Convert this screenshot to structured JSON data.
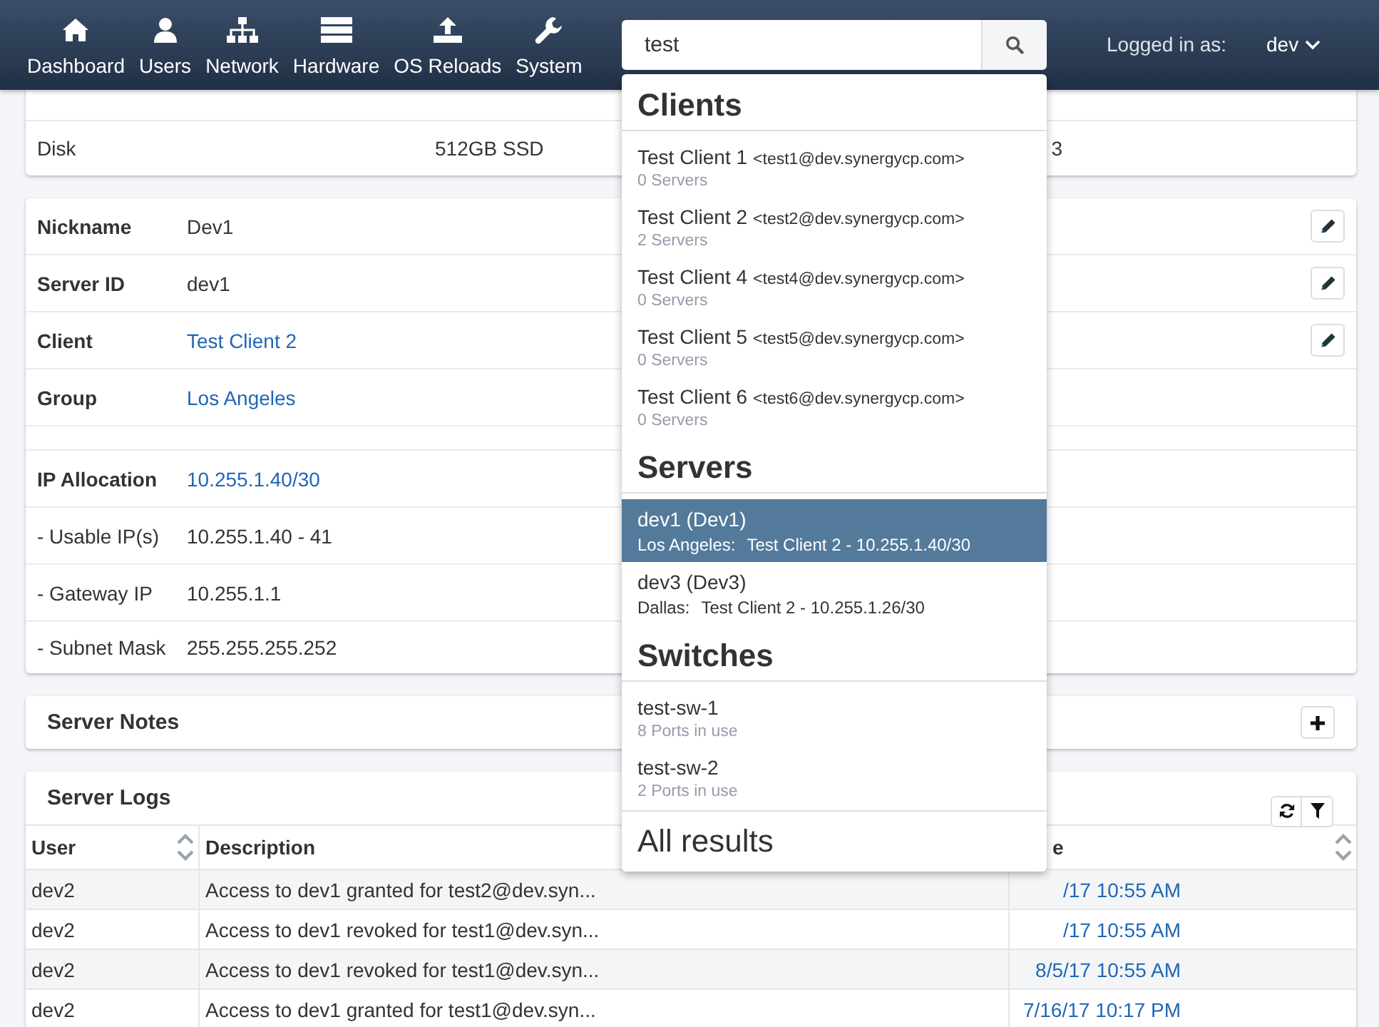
{
  "nav": [
    {
      "label": "Dashboard"
    },
    {
      "label": "Users"
    },
    {
      "label": "Network"
    },
    {
      "label": "Hardware"
    },
    {
      "label": "OS Reloads"
    },
    {
      "label": "System"
    }
  ],
  "search": {
    "value": "test"
  },
  "account": {
    "label": "Logged in as:",
    "name": "dev"
  },
  "specs": [
    {
      "label": "Disk",
      "value": "512GB SSD",
      "column_3": "3"
    }
  ],
  "details": [
    {
      "kind": "field",
      "label": "Nickname",
      "value": "Dev1",
      "bold": true,
      "link": false,
      "editable": true
    },
    {
      "kind": "field",
      "label": "Server ID",
      "value": "dev1",
      "bold": true,
      "link": false,
      "editable": true
    },
    {
      "kind": "field",
      "label": "Client",
      "value": "Test Client 2",
      "bold": true,
      "link": true,
      "editable": true
    },
    {
      "kind": "field",
      "label": "Group",
      "value": "Los Angeles",
      "bold": true,
      "link": true,
      "editable": false
    },
    {
      "kind": "spacer"
    },
    {
      "kind": "field",
      "label": "IP Allocation",
      "value": "10.255.1.40/30",
      "bold": true,
      "link": true,
      "editable": false
    },
    {
      "kind": "field",
      "label": "- Usable IP(s)",
      "value": "10.255.1.40 - 41",
      "bold": false,
      "link": false,
      "editable": false
    },
    {
      "kind": "field",
      "label": "- Gateway IP",
      "value": "10.255.1.1",
      "bold": false,
      "link": false,
      "editable": false
    },
    {
      "kind": "field",
      "label": "- Subnet Mask",
      "value": "255.255.255.252",
      "bold": false,
      "link": false,
      "editable": false
    }
  ],
  "notes": {
    "title": "Server Notes"
  },
  "logs": {
    "title": "Server Logs",
    "columns": [
      {
        "label": "User",
        "sortable": true
      },
      {
        "label": "Description"
      },
      {
        "label": "e",
        "sortable": true
      }
    ],
    "rows": [
      {
        "user": "dev2",
        "description": "Access to dev1 granted for test2@dev.syn...",
        "date": "/17 10:55 AM"
      },
      {
        "user": "dev2",
        "description": "Access to dev1 revoked for test1@dev.syn...",
        "date": "/17 10:55 AM"
      },
      {
        "user": "dev2",
        "description": "Access to dev1 revoked for test1@dev.syn...",
        "date": "8/5/17 10:55 AM"
      },
      {
        "user": "dev2",
        "description": "Access to dev1 granted for test1@dev.syn...",
        "date": "7/16/17 10:17 PM"
      }
    ]
  },
  "dropdown": {
    "sections": [
      {
        "title": "Clients",
        "kind": "client",
        "items": [
          {
            "name": "Test Client 1",
            "email": "<test1@dev.synergycp.com>",
            "detail": "0 Servers",
            "selected": false
          },
          {
            "name": "Test Client 2",
            "email": "<test2@dev.synergycp.com>",
            "detail": "2 Servers",
            "selected": false
          },
          {
            "name": "Test Client 4",
            "email": "<test4@dev.synergycp.com>",
            "detail": "0 Servers",
            "selected": false
          },
          {
            "name": "Test Client 5",
            "email": "<test5@dev.synergycp.com>",
            "detail": "0 Servers",
            "selected": false
          },
          {
            "name": "Test Client 6",
            "email": "<test6@dev.synergycp.com>",
            "detail": "0 Servers",
            "selected": false
          }
        ]
      },
      {
        "title": "Servers",
        "kind": "server",
        "items": [
          {
            "name": "dev1 (Dev1)",
            "location": "Los Angeles:",
            "detail": "Test Client 2 - 10.255.1.40/30",
            "selected": true
          },
          {
            "name": "dev3 (Dev3)",
            "location": "Dallas:",
            "detail": "Test Client 2 - 10.255.1.26/30",
            "selected": false
          }
        ]
      },
      {
        "title": "Switches",
        "kind": "switch",
        "items": [
          {
            "name": "test-sw-1",
            "detail": "8 Ports in use",
            "selected": false
          },
          {
            "name": "test-sw-2",
            "detail": "2 Ports in use",
            "selected": false
          }
        ]
      }
    ],
    "footer": "All results"
  }
}
